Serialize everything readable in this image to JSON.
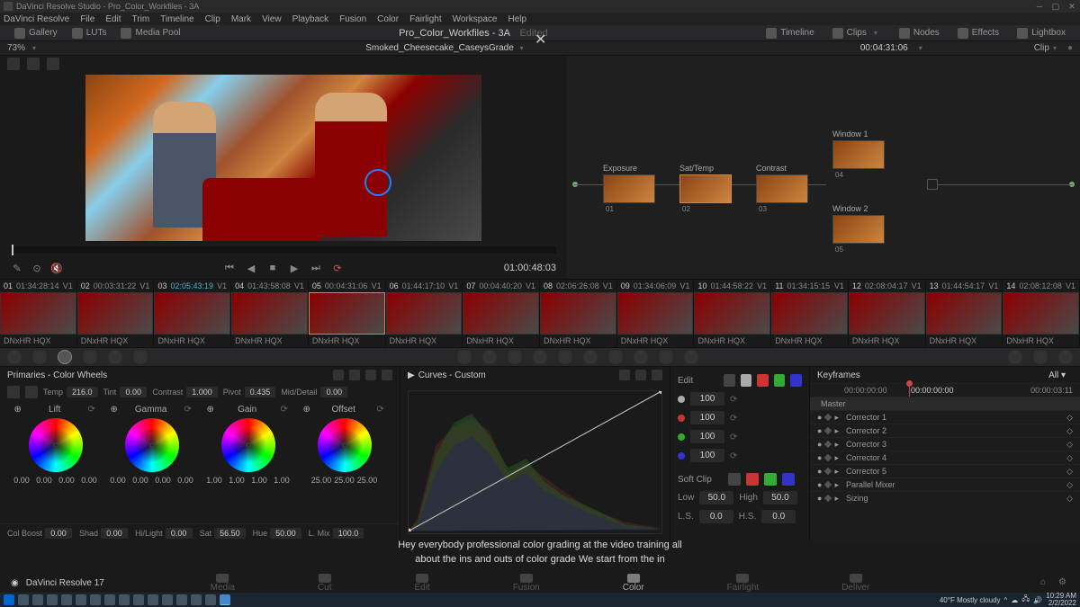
{
  "title_bar": "DaVinci Resolve Studio - Pro_Color_Workfiles - 3A",
  "menus": [
    "DaVinci Resolve",
    "File",
    "Edit",
    "Trim",
    "Timeline",
    "Clip",
    "Mark",
    "View",
    "Playback",
    "Fusion",
    "Color",
    "Fairlight",
    "Workspace",
    "Help"
  ],
  "top_toolbar": {
    "gallery": "Gallery",
    "luts": "LUTs",
    "media_pool": "Media Pool",
    "project": "Pro_Color_Workfiles - 3A",
    "edited": "Edited",
    "timeline": "Timeline",
    "clips": "Clips",
    "nodes": "Nodes",
    "effects": "Effects",
    "lightbox": "Lightbox"
  },
  "sub_toolbar": {
    "zoom": "73%",
    "clip": "Smoked_Cheesecake_CaseysGrade",
    "tc": "00:04:31:06",
    "clip_mode": "Clip"
  },
  "nodes": {
    "n1": {
      "label": "Exposure",
      "num": "01"
    },
    "n2": {
      "label": "Sat/Temp",
      "num": "02"
    },
    "n3": {
      "label": "Contrast",
      "num": "03"
    },
    "n4": {
      "label": "Window 1",
      "num": "04"
    },
    "n5": {
      "label": "Window 2",
      "num": "05"
    }
  },
  "transport": {
    "tc": "01:00:48:03"
  },
  "thumbs": [
    {
      "num": "01",
      "tc": "01:34:28:14",
      "track": "V1",
      "codec": "DNxHR HQX"
    },
    {
      "num": "02",
      "tc": "00:03:31:22",
      "track": "V1",
      "codec": "DNxHR HQX"
    },
    {
      "num": "03",
      "tc": "02:05:43:19",
      "track": "V1",
      "codec": "DNxHR HQX"
    },
    {
      "num": "04",
      "tc": "01:43:58:08",
      "track": "V1",
      "codec": "DNxHR HQX"
    },
    {
      "num": "05",
      "tc": "00:04:31:06",
      "track": "V1",
      "codec": "DNxHR HQX"
    },
    {
      "num": "06",
      "tc": "01:44:17:10",
      "track": "V1",
      "codec": "DNxHR HQX"
    },
    {
      "num": "07",
      "tc": "00:04:40:20",
      "track": "V1",
      "codec": "DNxHR HQX"
    },
    {
      "num": "08",
      "tc": "02:06:26:08",
      "track": "V1",
      "codec": "DNxHR HQX"
    },
    {
      "num": "09",
      "tc": "01:34:06:09",
      "track": "V1",
      "codec": "DNxHR HQX"
    },
    {
      "num": "10",
      "tc": "01:44:58:22",
      "track": "V1",
      "codec": "DNxHR HQX"
    },
    {
      "num": "11",
      "tc": "01:34:15:15",
      "track": "V1",
      "codec": "DNxHR HQX"
    },
    {
      "num": "12",
      "tc": "02:08:04:17",
      "track": "V1",
      "codec": "DNxHR HQX"
    },
    {
      "num": "13",
      "tc": "01:44:54:17",
      "track": "V1",
      "codec": "DNxHR HQX"
    },
    {
      "num": "14",
      "tc": "02:08:12:08",
      "track": "V1",
      "codec": "DNxHR HQX"
    }
  ],
  "wheels": {
    "title": "Primaries - Color Wheels",
    "adjusters": {
      "temp": {
        "label": "Temp",
        "val": "216.0"
      },
      "tint": {
        "label": "Tint",
        "val": "0.00"
      },
      "contrast": {
        "label": "Contrast",
        "val": "1.000"
      },
      "pivot": {
        "label": "Pivot",
        "val": "0.435"
      },
      "md": {
        "label": "Mid/Detail",
        "val": "0.00"
      }
    },
    "items": [
      {
        "name": "Lift",
        "vals": [
          "0.00",
          "0.00",
          "0.00",
          "0.00"
        ]
      },
      {
        "name": "Gamma",
        "vals": [
          "0.00",
          "0.00",
          "0.00",
          "0.00"
        ]
      },
      {
        "name": "Gain",
        "vals": [
          "1.00",
          "1.00",
          "1.00",
          "1.00"
        ]
      },
      {
        "name": "Offset",
        "vals": [
          "25.00",
          "25.00",
          "25.00"
        ]
      }
    ],
    "bottom": {
      "colboost": {
        "label": "Col Boost",
        "val": "0.00"
      },
      "shad": {
        "label": "Shad",
        "val": "0.00"
      },
      "hilight": {
        "label": "Hi/Light",
        "val": "0.00"
      },
      "sat": {
        "label": "Sat",
        "val": "56.50"
      },
      "hue": {
        "label": "Hue",
        "val": "50.00"
      },
      "lmix": {
        "label": "L. Mix",
        "val": "100.0"
      }
    }
  },
  "curves": {
    "title": "Curves - Custom",
    "y": "Y",
    "r": "R",
    "g": "G",
    "b": "B"
  },
  "edit": {
    "label": "Edit",
    "softclip": "Soft Clip",
    "vals": [
      "100",
      "100",
      "100",
      "100"
    ],
    "low": {
      "label": "Low",
      "val": "50.0"
    },
    "high": {
      "label": "High",
      "val": "50.0"
    },
    "ls": {
      "label": "L.S.",
      "val": "0.0"
    },
    "hs": {
      "label": "H.S.",
      "val": "0.0"
    }
  },
  "keyframes": {
    "title": "Keyframes",
    "all": "All",
    "tc_start": "00:00:00:00",
    "tc_cur": "00:00:00:00",
    "tc_end": "00:00:03:11",
    "master": "Master",
    "tracks": [
      "Corrector 1",
      "Corrector 2",
      "Corrector 3",
      "Corrector 4",
      "Corrector 5",
      "Parallel Mixer",
      "Sizing"
    ]
  },
  "subtitle": "Hey everybody professional color grading at the video training all about the ins and outs of color grade We start from the in",
  "pages": {
    "media": "Media",
    "cut": "Cut",
    "edit": "Edit",
    "fusion": "Fusion",
    "color": "Color",
    "fairlight": "Fairlight",
    "deliver": "Deliver",
    "app": "DaVinci Resolve 17"
  },
  "system": {
    "weather": "40°F  Mostly cloudy",
    "time": "10:29 AM",
    "date": "2/2/2022"
  }
}
